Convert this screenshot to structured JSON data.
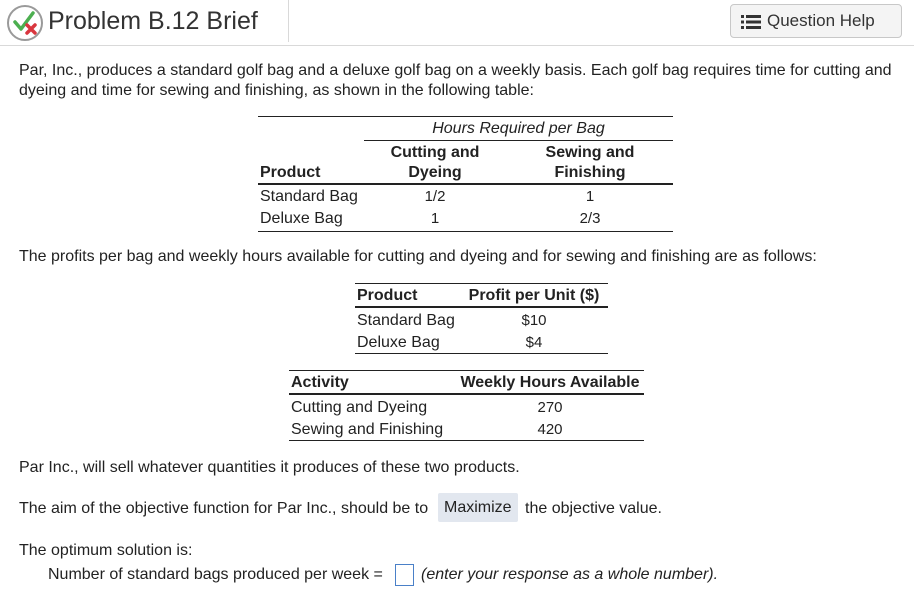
{
  "header": {
    "title": "Problem B.12 Brief",
    "help_label": "Question Help"
  },
  "intro": {
    "line1": "Par, Inc., produces a standard golf bag and a deluxe golf bag on a weekly basis. Each golf bag requires time for cutting and",
    "line2": "dyeing and time for sewing and finishing, as shown in the following table:"
  },
  "hours_table": {
    "group_header": "Hours Required per Bag",
    "col_product": "Product",
    "col1_line1": "Cutting and",
    "col1_line2": "Dyeing",
    "col2_line1": "Sewing and",
    "col2_line2": "Finishing",
    "rows": [
      {
        "product": "Standard Bag",
        "cutting": "1/2",
        "sewing": "1"
      },
      {
        "product": "Deluxe Bag",
        "cutting": "1",
        "sewing": "2/3"
      }
    ]
  },
  "profits_intro": "The profits per bag and weekly hours available for cutting and dyeing and for sewing and finishing are as follows:",
  "profit_table": {
    "col_product": "Product",
    "col_profit": "Profit per Unit ($)",
    "rows": [
      {
        "product": "Standard Bag",
        "profit": "$10"
      },
      {
        "product": "Deluxe Bag",
        "profit": "$4"
      }
    ]
  },
  "hours_available_table": {
    "col_activity": "Activity",
    "col_hours": "Weekly Hours Available",
    "rows": [
      {
        "activity": "Cutting and Dyeing",
        "hours": "270"
      },
      {
        "activity": "Sewing and Finishing",
        "hours": "420"
      }
    ]
  },
  "sell_statement": "Par Inc., will sell whatever quantities it produces of these two products.",
  "objective": {
    "before": "The aim of the objective function for Par Inc., should be to",
    "selected": "Maximize",
    "after": "the objective value."
  },
  "optimum_label": "The optimum solution is:",
  "answer": {
    "prompt": "Number of standard bags produced per week =",
    "value": "",
    "hint": "(enter your response as a whole number)."
  },
  "colors": {
    "select_bg": "#e2e7ef",
    "input_border": "#4a80c8",
    "icon_green": "#4caf50",
    "icon_red": "#d9363e"
  },
  "icons": [
    "status-check-x-icon",
    "list-icon"
  ]
}
